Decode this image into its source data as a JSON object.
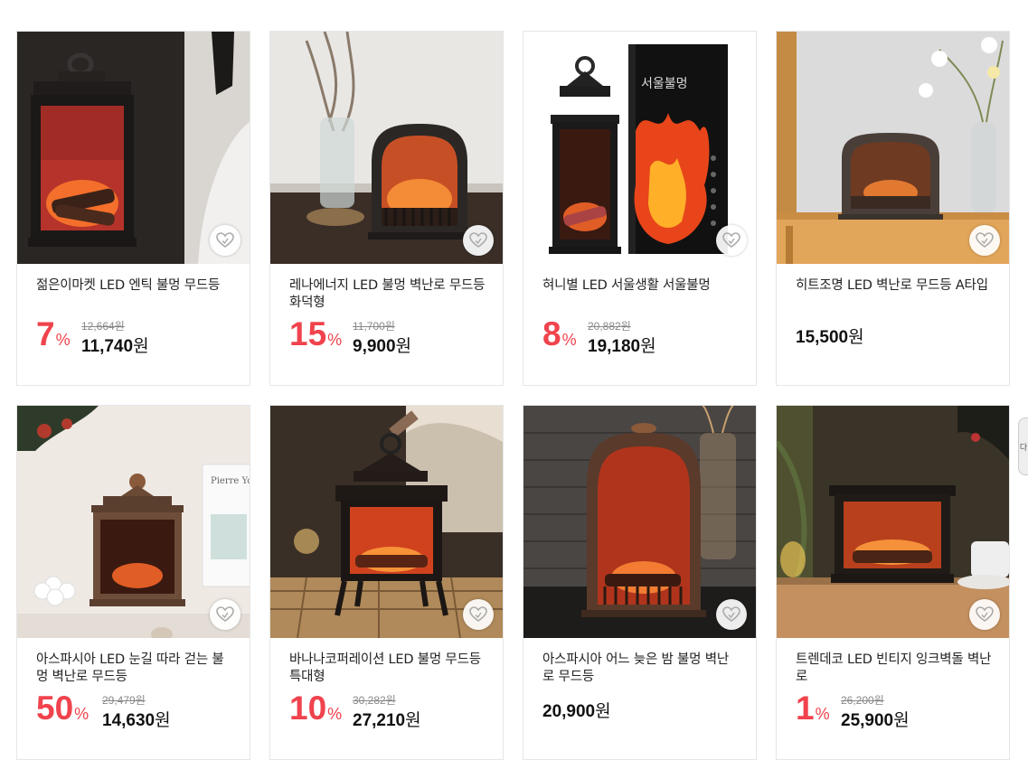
{
  "products": [
    {
      "title": "젊은이마켓 LED 엔틱 불멍 무드등",
      "discount": "7",
      "percent": "%",
      "original": "12,664원",
      "price": "11,740",
      "won": "원"
    },
    {
      "title": "레나에너지 LED 불멍 벽난로 무드등 화덕형",
      "discount": "15",
      "percent": "%",
      "original": "11,700원",
      "price": "9,900",
      "won": "원"
    },
    {
      "title": "혀니별 LED 서울생활 서울불멍",
      "discount": "8",
      "percent": "%",
      "original": "20,882원",
      "price": "19,180",
      "won": "원",
      "box_text": "서울불멍"
    },
    {
      "title": "히트조명 LED 벽난로 무드등 A타입",
      "price": "15,500",
      "won": "원"
    },
    {
      "title": "아스파시아 LED 눈길 따라 걷는 불멍 벽난로 무드등",
      "discount": "50",
      "percent": "%",
      "original": "29,479원",
      "price": "14,630",
      "won": "원",
      "card_text": "Pierre Yo"
    },
    {
      "title": "바나나코퍼레이션 LED 불멍 무드등 특대형",
      "discount": "10",
      "percent": "%",
      "original": "30,282원",
      "price": "27,210",
      "won": "원"
    },
    {
      "title": "아스파시아 어느 늦은 밤 불멍 벽난로 무드등",
      "price": "20,900",
      "won": "원"
    },
    {
      "title": "트렌데코 LED 빈티지 잉크벽돌 벽난로",
      "discount": "1",
      "percent": "%",
      "original": "26,200원",
      "price": "25,900",
      "won": "원"
    }
  ],
  "side_tab_label": "다",
  "colors": {
    "discount": "#f0434d",
    "border": "#e6e6e6"
  }
}
